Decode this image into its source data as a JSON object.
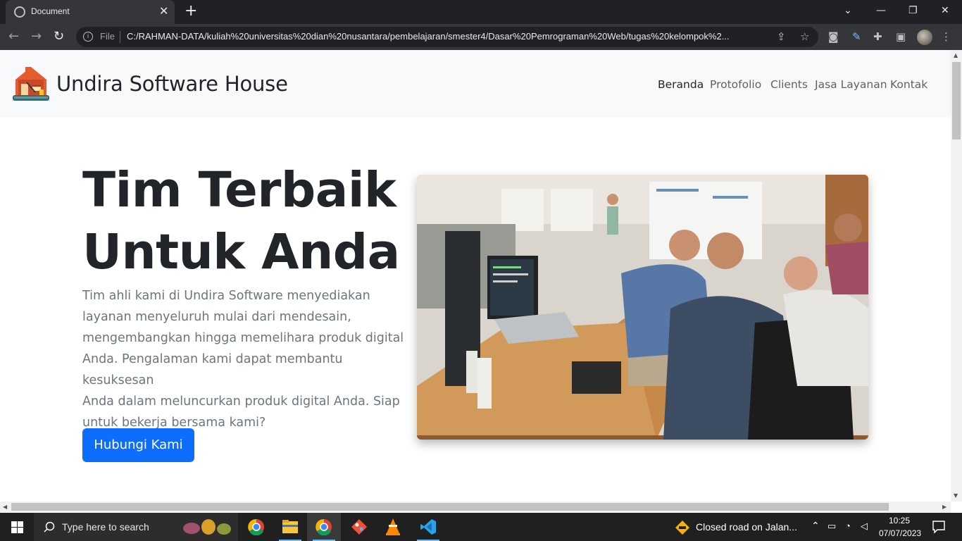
{
  "browser": {
    "tab_title": "Document",
    "tab_close": "✕",
    "new_tab": "+",
    "file_label": "File",
    "url": "C:/RAHMAN-DATA/kuliah%20universitas%20dian%20nusantara/pembelajaran/smester4/Dasar%20Pemrograman%20Web/tugas%20kelompok%2...",
    "icons": [
      "globe-icon",
      "back-icon",
      "forward-icon",
      "reload-icon",
      "info-icon",
      "share-icon",
      "star-icon",
      "camera-icon",
      "extension-icon",
      "puzzle-icon",
      "sidepanel-icon",
      "avatar",
      "menu-icon"
    ]
  },
  "site": {
    "brand": "Undira Software House",
    "nav": [
      {
        "label": "Beranda",
        "active": true
      },
      {
        "label": "Protofolio",
        "active": false
      },
      {
        "label": "Clients",
        "active": false
      },
      {
        "label": "Jasa Layanan",
        "active": false
      },
      {
        "label": "Kontak",
        "active": false
      }
    ],
    "hero": {
      "title_line1": "Tim Terbaik",
      "title_line2": "Untuk Anda",
      "text_lines": [
        "Tim ahli kami di Undira Software menyediakan",
        "layanan menyeluruh mulai dari mendesain,",
        "mengembangkan hingga memelihara produk digital",
        "Anda. Pengalaman kami dapat membantu kesuksesan",
        "Anda dalam meluncurkan produk digital Anda. Siap",
        "untuk bekerja bersama kami?"
      ],
      "button": "Hubungi Kami"
    }
  },
  "taskbar": {
    "search_placeholder": "Type here to search",
    "news": "Closed road on Jalan...",
    "time": "10:25",
    "date": "07/07/2023"
  },
  "colors": {
    "primary": "#0d6efd",
    "navbar_bg": "#f8f9fa",
    "heading": "#212529",
    "muted": "#6c757d"
  }
}
